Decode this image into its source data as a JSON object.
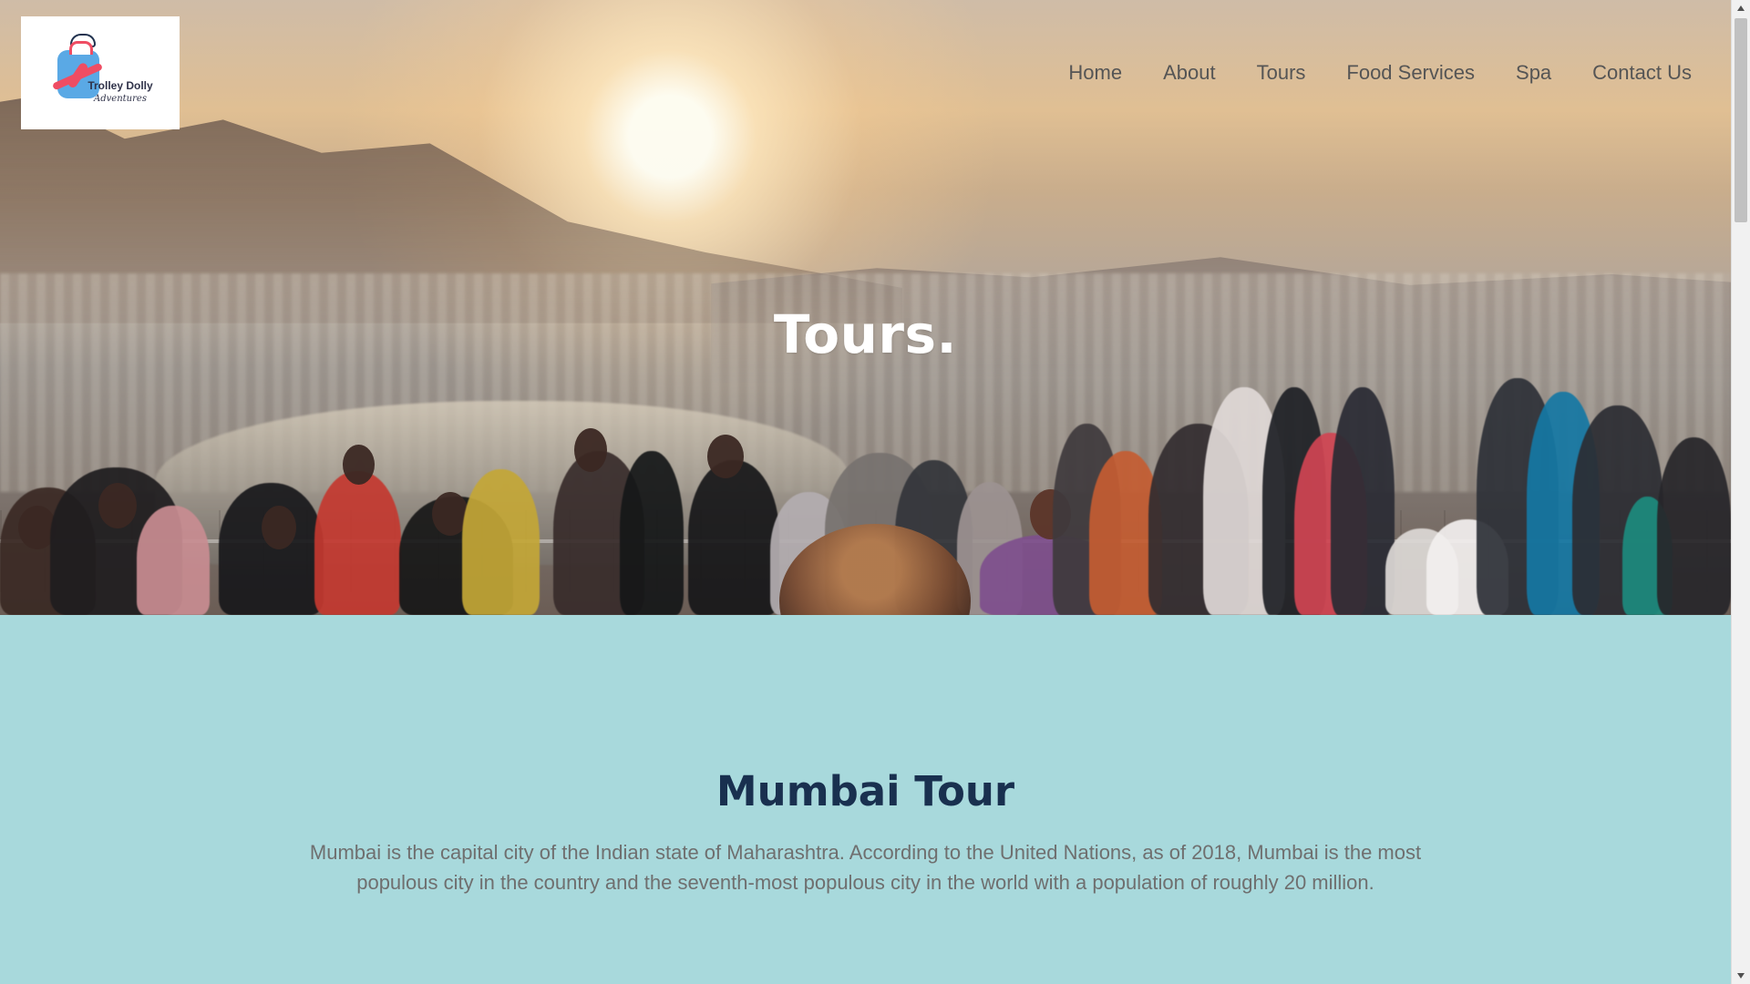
{
  "browser": {
    "scrollbar_label": ""
  },
  "header": {
    "logo": {
      "brand_line_1": "Trolley Dolly",
      "brand_line_2": "Adventures",
      "icon": "suitcase-plane-logo"
    },
    "nav": [
      {
        "label": "Home"
      },
      {
        "label": "About"
      },
      {
        "label": "Tours"
      },
      {
        "label": "Food Services"
      },
      {
        "label": "Spa"
      },
      {
        "label": "Contact Us"
      }
    ]
  },
  "hero": {
    "title": "Tours.",
    "image_subject": "crowd-viewing-sunset-over-city"
  },
  "tour_section": {
    "title": "Mumbai Tour",
    "description": "Mumbai is the capital city of the Indian state of Maharashtra. According to the United Nations, as of 2018, Mumbai is the most populous city in the country and the seventh-most populous city in the world with a population of roughly 20 million.",
    "background_color": "#a8d9dc",
    "title_color": "#19304f",
    "text_color": "#6f6f6f"
  },
  "theme": {
    "nav_text_color": "#555555",
    "hero_title_color": "#ffffff",
    "logo_blue": "#5aa9e5",
    "logo_red": "#ef4d63",
    "logo_navy": "#2f3249"
  }
}
